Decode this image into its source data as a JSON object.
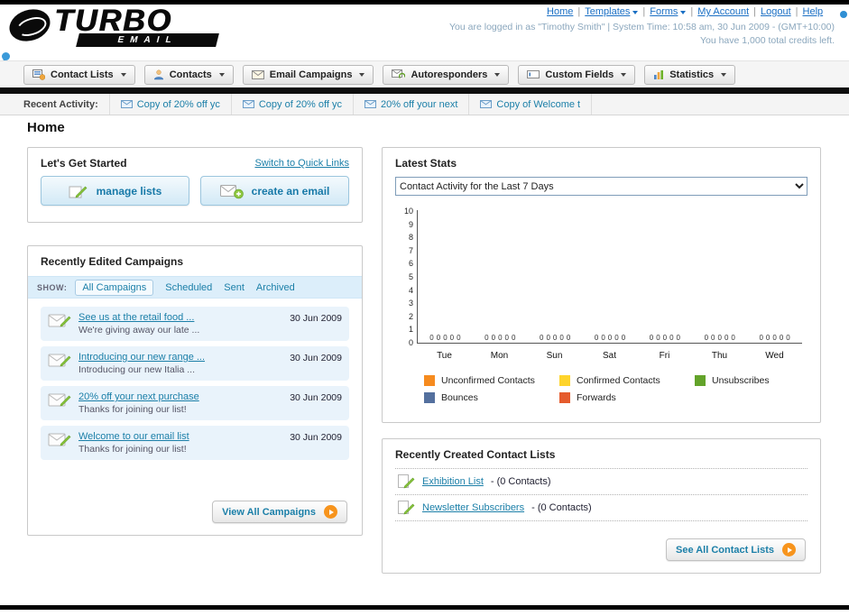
{
  "brand": {
    "name_top": "TURBO",
    "name_bottom": "EMAIL"
  },
  "top_bar": {
    "links": [
      {
        "label": "Home",
        "dropdown": false
      },
      {
        "label": "Templates",
        "dropdown": true
      },
      {
        "label": "Forms",
        "dropdown": true
      },
      {
        "label": "My Account",
        "dropdown": false
      },
      {
        "label": "Logout",
        "dropdown": false
      },
      {
        "label": "Help",
        "dropdown": false
      }
    ],
    "session_line": "You are logged in as \"Timothy Smith\" | System Time: 10:58 am, 30 Jun 2009 - (GMT+10:00)",
    "credits_line": "You have 1,000 total credits left."
  },
  "main_nav": {
    "items": [
      {
        "label": "Contact Lists"
      },
      {
        "label": "Contacts"
      },
      {
        "label": "Email Campaigns"
      },
      {
        "label": "Autoresponders"
      },
      {
        "label": "Custom Fields"
      },
      {
        "label": "Statistics"
      }
    ]
  },
  "recent_activity": {
    "label": "Recent Activity:",
    "items": [
      {
        "label": "Copy of 20% off yc"
      },
      {
        "label": "Copy of 20% off yc"
      },
      {
        "label": "20% off your next"
      },
      {
        "label": "Copy of Welcome t"
      }
    ]
  },
  "page": {
    "title": "Home"
  },
  "get_started": {
    "title": "Let's Get Started",
    "switch_link": "Switch to Quick Links",
    "manage_lists_label": "manage lists",
    "create_email_label": "create an email"
  },
  "campaigns": {
    "title": "Recently Edited Campaigns",
    "show_label": "SHOW:",
    "tabs": [
      {
        "label": "All Campaigns",
        "active": true
      },
      {
        "label": "Scheduled",
        "active": false
      },
      {
        "label": "Sent",
        "active": false
      },
      {
        "label": "Archived",
        "active": false
      }
    ],
    "items": [
      {
        "title": "See us at the retail food ...",
        "subtitle": "We're giving away our late ...",
        "date": "30 Jun 2009"
      },
      {
        "title": "Introducing our new range ...",
        "subtitle": "Introducing our new Italia ...",
        "date": "30 Jun 2009"
      },
      {
        "title": "20% off your next purchase",
        "subtitle": "Thanks for joining our list!",
        "date": "30 Jun 2009"
      },
      {
        "title": "Welcome to our email list",
        "subtitle": "Thanks for joining our list!",
        "date": "30 Jun 2009"
      }
    ],
    "view_all_label": "View All Campaigns"
  },
  "latest_stats": {
    "title": "Latest Stats",
    "period_option": "Contact Activity for the Last 7 Days"
  },
  "chart_data": {
    "type": "bar",
    "title": "Contact Activity for the Last 7 Days",
    "categories": [
      "Tue",
      "Mon",
      "Sun",
      "Sat",
      "Fri",
      "Thu",
      "Wed"
    ],
    "series": [
      {
        "name": "Unconfirmed Contacts",
        "color": "#f68b1f",
        "values": [
          0,
          0,
          0,
          0,
          0,
          0,
          0
        ]
      },
      {
        "name": "Confirmed Contacts",
        "color": "#fed42c",
        "values": [
          0,
          0,
          0,
          0,
          0,
          0,
          0
        ]
      },
      {
        "name": "Unsubscribes",
        "color": "#63a32a",
        "values": [
          0,
          0,
          0,
          0,
          0,
          0,
          0
        ]
      },
      {
        "name": "Bounces",
        "color": "#54709e",
        "values": [
          0,
          0,
          0,
          0,
          0,
          0,
          0
        ]
      },
      {
        "name": "Forwards",
        "color": "#e55b2d",
        "values": [
          0,
          0,
          0,
          0,
          0,
          0,
          0
        ]
      }
    ],
    "ylim": [
      0,
      10
    ],
    "yticks": [
      10,
      9,
      8,
      7,
      6,
      5,
      4,
      3,
      2,
      1,
      0
    ],
    "grid": false,
    "legend_position": "bottom",
    "value_labels_shown": true
  },
  "contact_lists": {
    "title": "Recently Created Contact Lists",
    "items": [
      {
        "name": "Exhibition List",
        "meta": "- (0 Contacts)"
      },
      {
        "name": "Newsletter Subscribers",
        "meta": "- (0 Contacts)"
      }
    ],
    "see_all_label": "See All Contact Lists"
  }
}
